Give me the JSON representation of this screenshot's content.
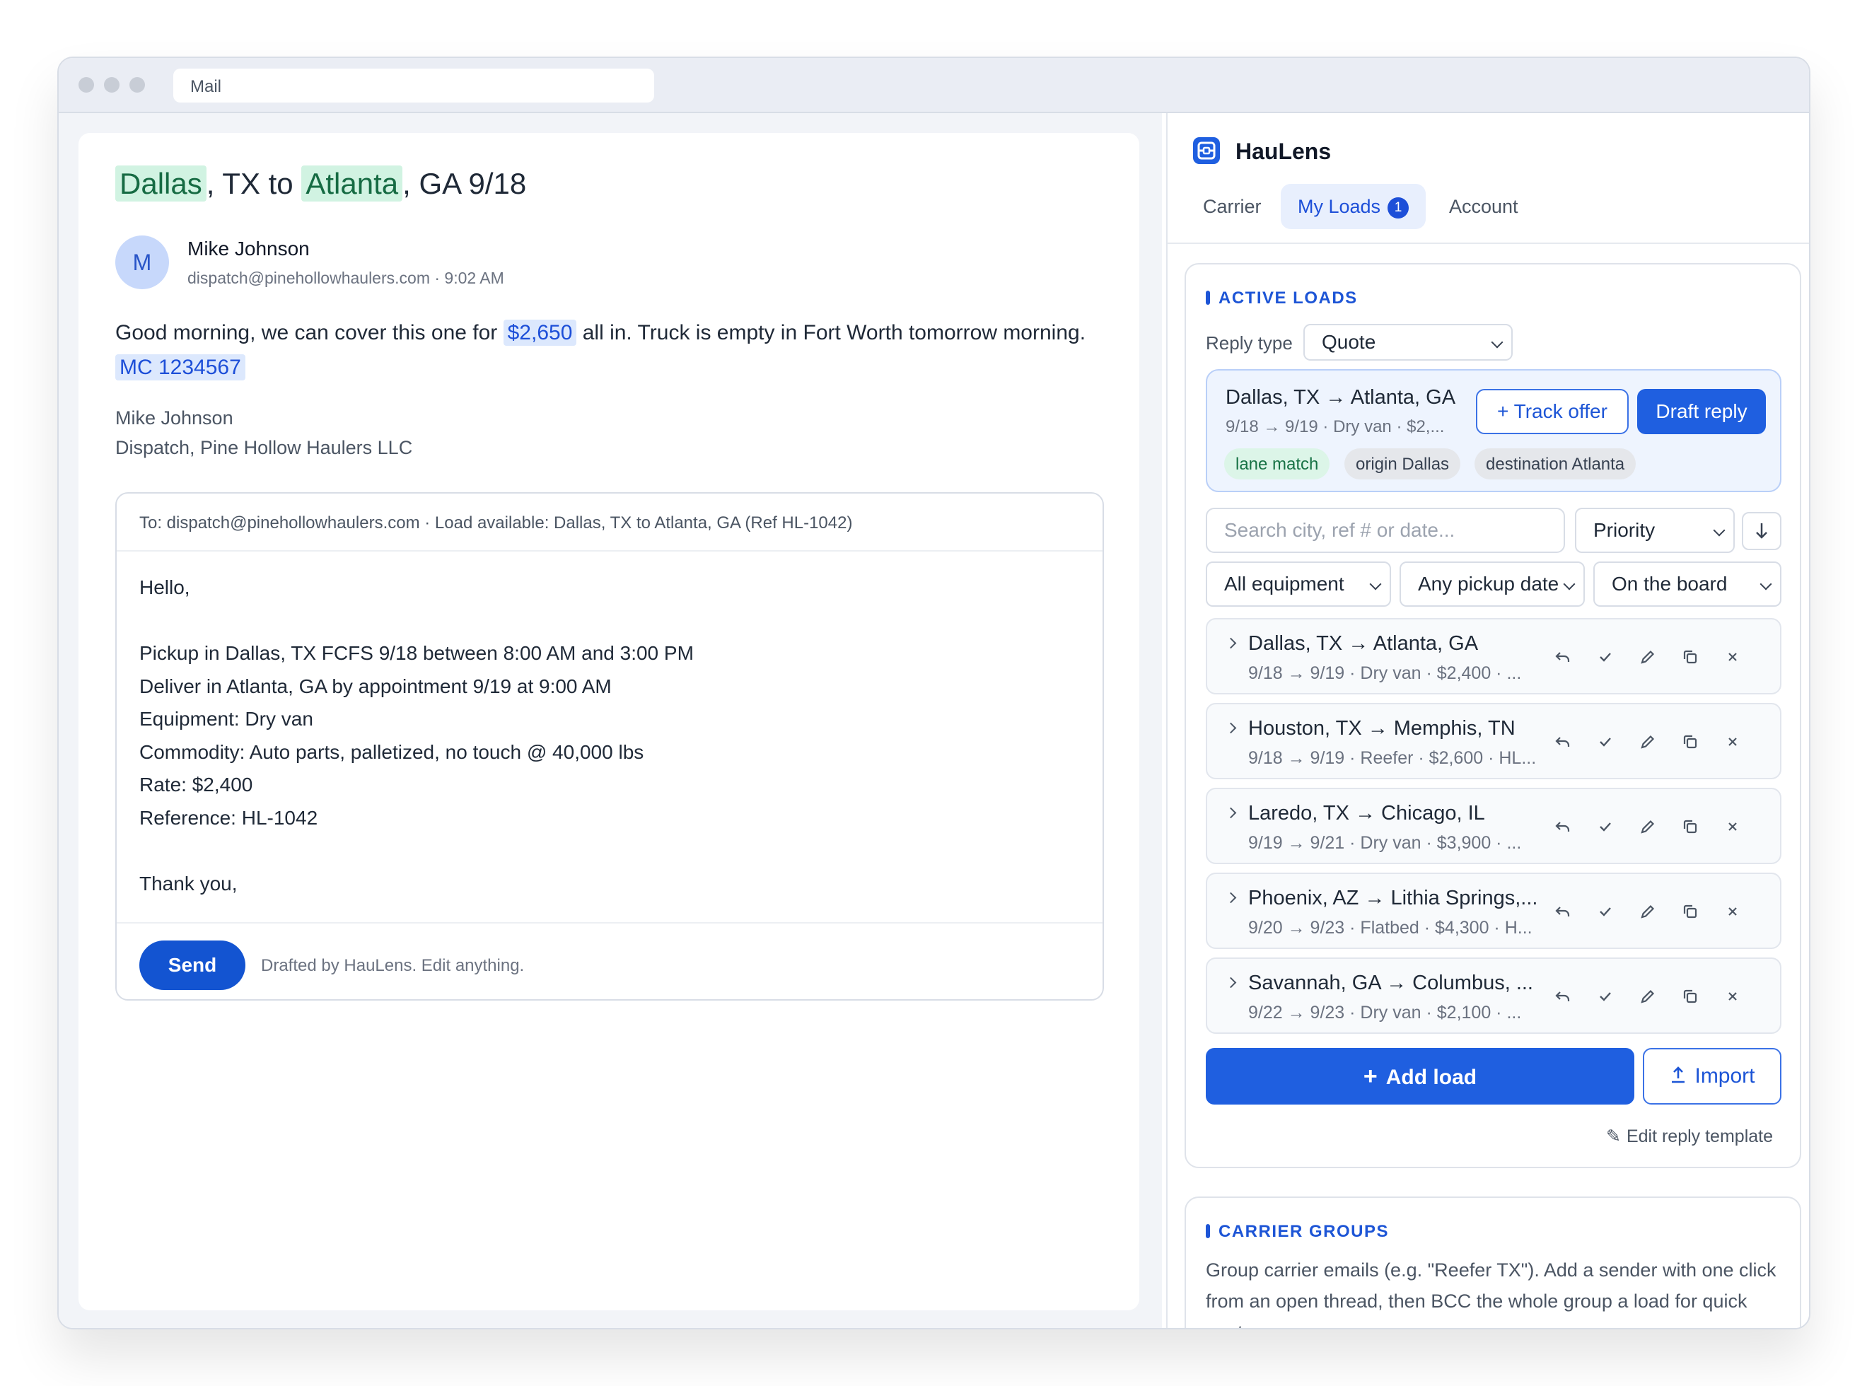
{
  "window": {
    "url_text": "Mail"
  },
  "email": {
    "subject_origin": "Dallas",
    "subject_mid": ", TX to ",
    "subject_dest": "Atlanta",
    "subject_end": ", GA 9/18",
    "sender_initial": "M",
    "sender_name": "Mike Johnson",
    "sender_meta": "dispatch@pinehollowhaulers.com · 9:02 AM",
    "body_pre": "Good morning, we can cover this one for ",
    "body_rate": "$2,650",
    "body_post": " all in. Truck is empty in Fort Worth tomorrow morning.",
    "body_mc": "MC 1234567",
    "signature_name": "Mike Johnson",
    "signature_company": "Dispatch, Pine Hollow Haulers LLC"
  },
  "reply": {
    "header": "To: dispatch@pinehollowhaulers.com  ·  Load available: Dallas, TX to Atlanta, GA (Ref HL-1042)",
    "body": "Hello,\n\nPickup in Dallas, TX FCFS 9/18 between 8:00 AM and 3:00 PM\nDeliver in Atlanta, GA by appointment 9/19 at 9:00 AM\nEquipment: Dry van\nCommodity: Auto parts, palletized, no touch @ 40,000 lbs\nRate: $2,400\nReference: HL-1042\n\nThank you,",
    "send_label": "Send",
    "drafted_note": "Drafted by HauLens. Edit anything."
  },
  "sidebar": {
    "brand": "HauLens",
    "tabs": [
      {
        "label": "Carrier"
      },
      {
        "label": "My Loads",
        "badge": "1"
      },
      {
        "label": "Account"
      }
    ],
    "active_tab": "My Loads",
    "active_loads": {
      "heading": "ACTIVE LOADS",
      "reply_type_label": "Reply type",
      "reply_type_value": "Quote",
      "featured": {
        "title": "Dallas, TX → Atlanta, GA",
        "sub": "9/18 → 9/19 · Dry van · $2,...",
        "track_label": "+ Track offer",
        "draft_label": "Draft reply",
        "tags": [
          "lane match",
          "origin Dallas",
          "destination Atlanta"
        ]
      },
      "search_placeholder": "Search city, ref # or date...",
      "sort_value": "Priority",
      "filters": [
        "All equipment",
        "Any pickup date",
        "On the board"
      ],
      "loads": [
        {
          "title": "Dallas, TX → Atlanta, GA",
          "sub": "9/18 → 9/19 · Dry van · $2,400 · ..."
        },
        {
          "title": "Houston, TX → Memphis, TN",
          "sub": "9/18 → 9/19 · Reefer · $2,600 · HL..."
        },
        {
          "title": "Laredo, TX → Chicago, IL",
          "sub": "9/19 → 9/21 · Dry van · $3,900 · ..."
        },
        {
          "title": "Phoenix, AZ → Lithia Springs,...",
          "sub": "9/20 → 9/23 · Flatbed · $4,300 · H..."
        },
        {
          "title": "Savannah, GA → Columbus, ...",
          "sub": "9/22 → 9/23 · Dry van · $2,100 · ..."
        }
      ],
      "add_label": "Add load",
      "import_label": "Import",
      "edit_template": "Edit reply template"
    },
    "carrier_groups": {
      "heading": "CARRIER GROUPS",
      "text": "Group carrier emails (e.g. \"Reefer TX\"). Add a sender with one click from an open thread, then BCC the whole group a load for quick quotes."
    }
  },
  "colors": {
    "accent": "#1f5fe0",
    "lane_green": "#166b43",
    "highlight_blue": "#dce8fd"
  },
  "icons": [
    "app-logo-icon",
    "chevron-down-icon",
    "sort-arrow-icon",
    "chevron-right-icon",
    "reply-icon",
    "check-icon",
    "pencil-icon",
    "copy-icon",
    "close-icon",
    "plus-icon",
    "upload-icon",
    "pencil-small-icon"
  ]
}
